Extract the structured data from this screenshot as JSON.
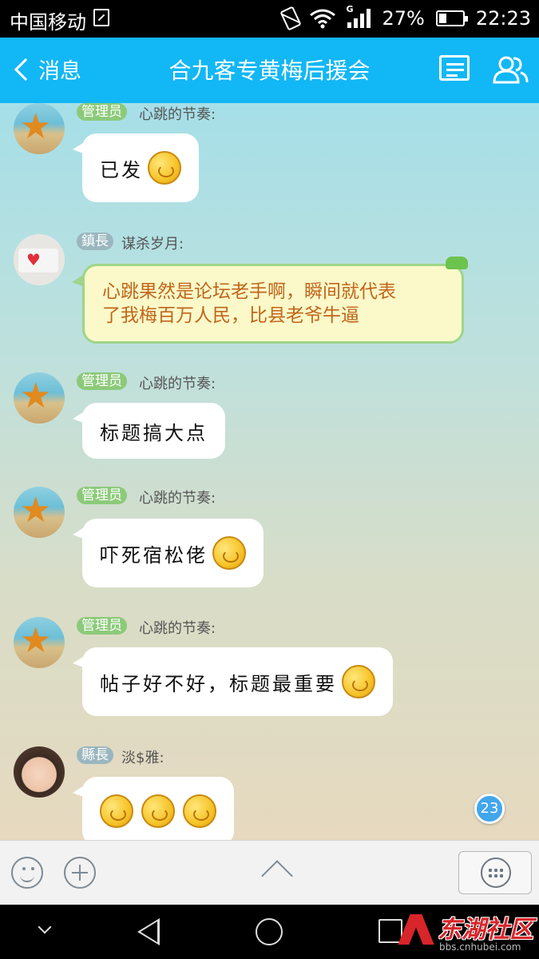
{
  "status_bar": {
    "carrier": "中国移动",
    "network": "G",
    "battery": "27%",
    "time": "22:23"
  },
  "header": {
    "back_label": "消息",
    "title": "合九客专黄梅后援会",
    "accent_color": "#12b7f5"
  },
  "messages": [
    {
      "badge": "管理员",
      "sender": "心跳的节奏:",
      "text": "已发",
      "emoji_count": 1,
      "avatar": "starfish-avatar"
    },
    {
      "badge": "鎮長",
      "sender": "谋杀岁月:",
      "text_lines": [
        "心跳果然是论坛老手啊，瞬间就代表",
        "了我梅百万人民，比县老爷牛逼"
      ],
      "avatar": "man-photo-avatar"
    },
    {
      "badge": "管理员",
      "sender": "心跳的节奏:",
      "text": "标题搞大点",
      "avatar": "starfish-avatar"
    },
    {
      "badge": "管理员",
      "sender": "心跳的节奏:",
      "text": "吓死宿松佬",
      "emoji_count": 1,
      "avatar": "starfish-avatar"
    },
    {
      "badge": "管理员",
      "sender": "心跳的节奏:",
      "text": "帖子好不好，标题最重要",
      "emoji_count": 1,
      "avatar": "starfish-avatar"
    },
    {
      "badge": "縣長",
      "sender": "淡$雅:",
      "text": "",
      "emoji_count": 3,
      "avatar": "girl-photo-avatar"
    }
  ],
  "unread_count": "23",
  "watermark": {
    "name": "东湖社区",
    "url": "bbs.cnhubei.com"
  }
}
